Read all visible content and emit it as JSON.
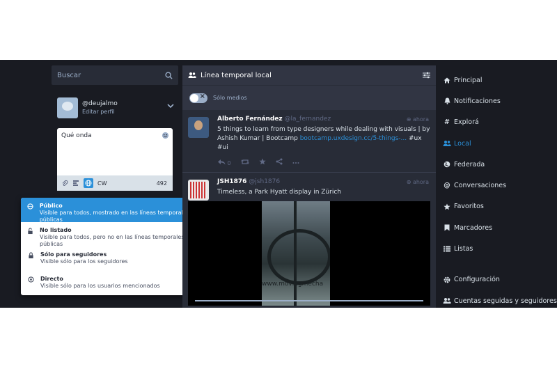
{
  "search": {
    "placeholder": "Buscar"
  },
  "profile": {
    "handle": "@deujalmo",
    "edit": "Editar perfil"
  },
  "compose": {
    "text": "Qué onda",
    "cw": "CW",
    "counter": "492"
  },
  "privacy": {
    "options": [
      {
        "title": "Público",
        "desc": "Visible para todos, mostrado en las líneas temporales públicas",
        "icon": "globe-icon"
      },
      {
        "title": "No listado",
        "desc": "Visible para todos, pero no en las líneas temporales públicas",
        "icon": "unlock-icon"
      },
      {
        "title": "Sólo para seguidores",
        "desc": "Visible sólo para los seguidores",
        "icon": "lock-icon"
      },
      {
        "title": "Directo",
        "desc": "Visible sólo para los usuarios mencionados",
        "icon": "at-icon"
      }
    ]
  },
  "column": {
    "title": "Línea temporal local",
    "only_media": "Sólo medios"
  },
  "statuses": [
    {
      "name": "Alberto Fernández",
      "handle": "@la_fernandez",
      "time": "ahora",
      "text": "5 things to learn from type designers while dealing with visuals | by Ashish Kumar | Bootcamp ",
      "link": "bootcamp.uxdesign.cc/5-things-...",
      "tag": " #ux #ui",
      "reply_count": "0"
    },
    {
      "name": "JSH1876",
      "handle": "@jsh1876",
      "time": "ahora",
      "text": "Timeless, a Park Hyatt display in Zürich",
      "watermark": "www.movingmecha"
    }
  ],
  "nav": {
    "items": [
      {
        "label": "Principal",
        "icon": "home-icon"
      },
      {
        "label": "Notificaciones",
        "icon": "bell-icon"
      },
      {
        "label": "Explorá",
        "icon": "hashtag-icon"
      },
      {
        "label": "Local",
        "icon": "users-icon"
      },
      {
        "label": "Federada",
        "icon": "globe-icon"
      },
      {
        "label": "Conversaciones",
        "icon": "at-icon"
      },
      {
        "label": "Favoritos",
        "icon": "star-icon"
      },
      {
        "label": "Marcadores",
        "icon": "bookmark-icon"
      },
      {
        "label": "Listas",
        "icon": "list-icon"
      }
    ],
    "settings": "Configuración",
    "follows": "Cuentas seguidas y seguidores"
  },
  "colors": {
    "accent": "#2b90d9",
    "bg": "#191b22",
    "panel": "#282c37"
  }
}
